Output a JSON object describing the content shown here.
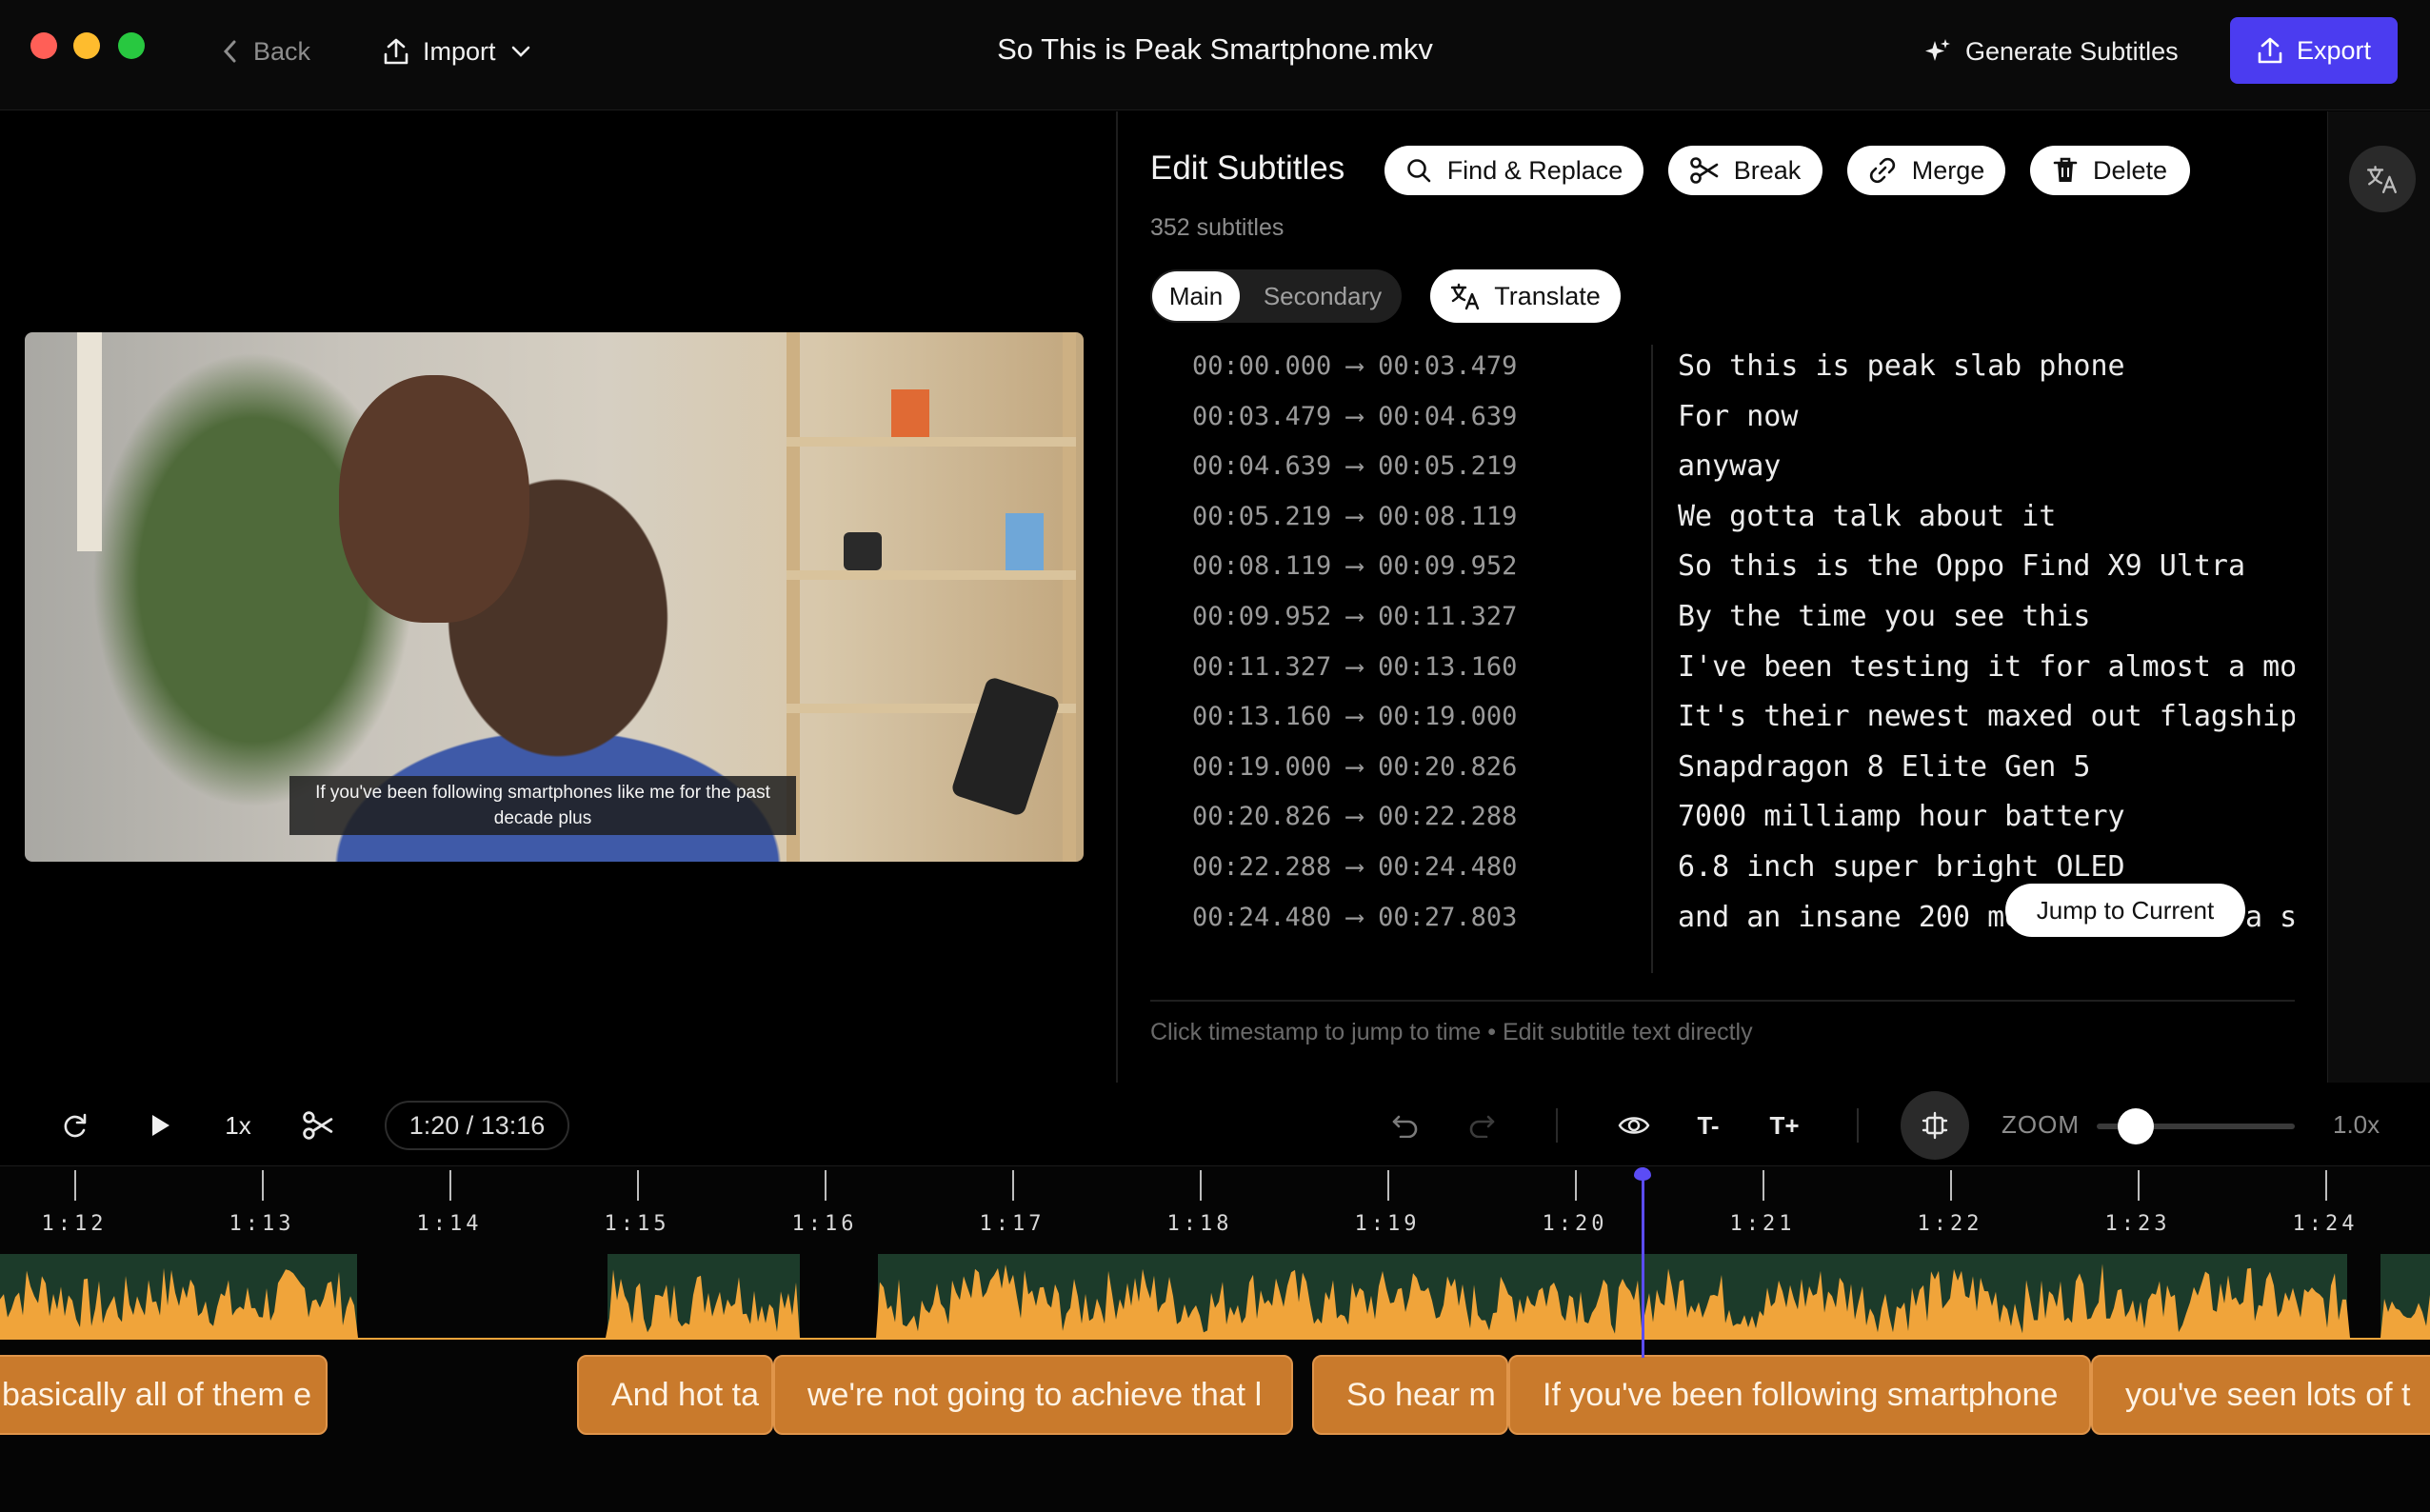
{
  "window": {
    "title": "So This is Peak Smartphone.mkv",
    "back_label": "Back",
    "import_label": "Import",
    "generate_label": "Generate Subtitles",
    "export_label": "Export",
    "accent": "#4b3cf0"
  },
  "video": {
    "caption": "If you've been following smartphones like me for the past decade plus"
  },
  "editor": {
    "title": "Edit Subtitles",
    "count": "352 subtitles",
    "actions": {
      "find_replace": "Find & Replace",
      "break": "Break",
      "merge": "Merge",
      "delete": "Delete"
    },
    "tabs": {
      "main": "Main",
      "secondary": "Secondary"
    },
    "translate_label": "Translate",
    "jump_label": "Jump to Current",
    "hint": "Click timestamp to jump to time • Edit subtitle text directly",
    "subtitles": [
      {
        "time": "00:00.000 ⟶ 00:03.479",
        "text": "So this is peak slab phone"
      },
      {
        "time": "00:03.479 ⟶ 00:04.639",
        "text": "For now"
      },
      {
        "time": "00:04.639 ⟶ 00:05.219",
        "text": "anyway"
      },
      {
        "time": "00:05.219 ⟶ 00:08.119",
        "text": "We gotta talk about it"
      },
      {
        "time": "00:08.119 ⟶ 00:09.952",
        "text": "So this is the Oppo Find X9 Ultra"
      },
      {
        "time": "00:09.952 ⟶ 00:11.327",
        "text": "By the time you see this"
      },
      {
        "time": "00:11.327 ⟶ 00:13.160",
        "text": "I've been testing it for almost a mo"
      },
      {
        "time": "00:13.160 ⟶ 00:19.000",
        "text": "It's their newest maxed out flagship"
      },
      {
        "time": "00:19.000 ⟶ 00:20.826",
        "text": "Snapdragon 8 Elite Gen 5"
      },
      {
        "time": "00:20.826 ⟶ 00:22.288",
        "text": "7000 milliamp hour battery"
      },
      {
        "time": "00:22.288 ⟶ 00:24.480",
        "text": "6.8 inch super bright OLED"
      },
      {
        "time": "00:24.480 ⟶ 00:27.803",
        "text": "and an insane 200 megapixel camera s"
      }
    ]
  },
  "toolbar": {
    "speed": "1x",
    "time_display": "1:20 / 13:16",
    "text_smaller": "T-",
    "text_larger": "T+",
    "zoom_label": "ZOOM",
    "zoom_value": "1.0x",
    "zoom_level": 0.1
  },
  "timeline": {
    "ticks": [
      "1:12",
      "1:13",
      "1:14",
      "1:15",
      "1:16",
      "1:17",
      "1:18",
      "1:19",
      "1:20",
      "1:21",
      "1:22",
      "1:23",
      "1:24"
    ],
    "playhead_time": "1:20.4",
    "clips": [
      "basically all of them e",
      "And hot ta",
      "we're not going to achieve that l",
      "So hear m",
      "If you've been following smartphone",
      "you've seen lots of t"
    ],
    "wave_color": "#f0a43a",
    "clip_color": "#c97a2c"
  }
}
